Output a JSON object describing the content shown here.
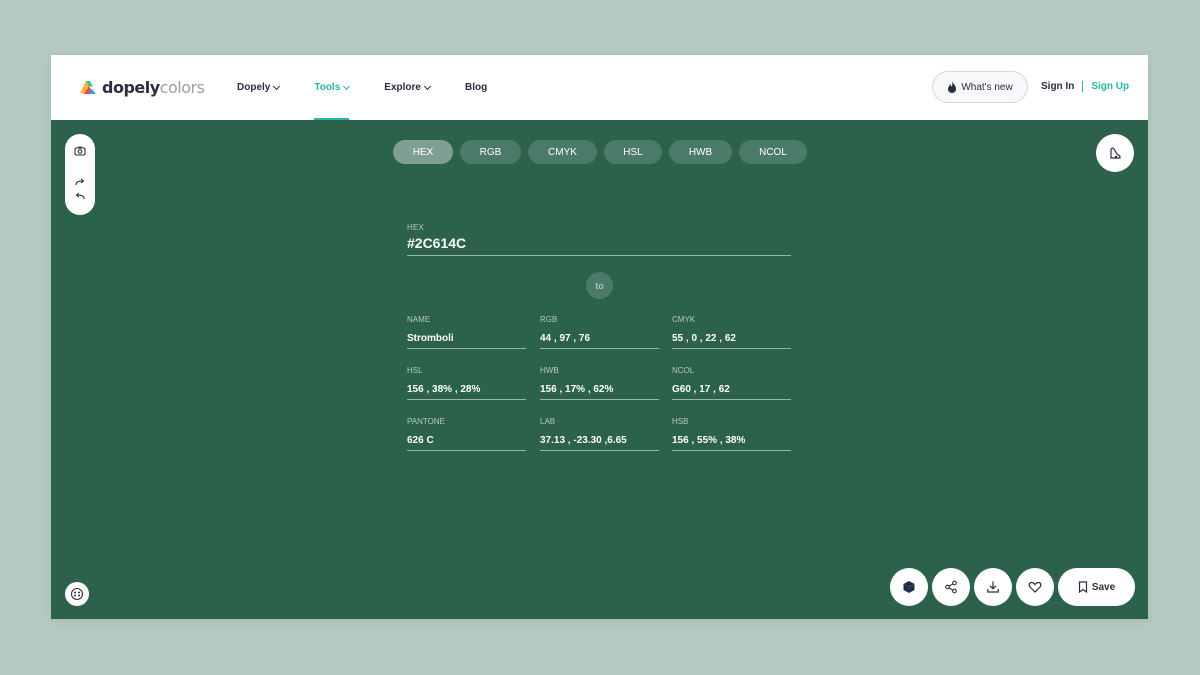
{
  "logo": {
    "part1": "dopely",
    "part2": "colors"
  },
  "nav": {
    "items": [
      {
        "label": "Dopely",
        "dropdown": true,
        "active": false
      },
      {
        "label": "Tools",
        "dropdown": true,
        "active": true
      },
      {
        "label": "Explore",
        "dropdown": true,
        "active": false
      },
      {
        "label": "Blog",
        "dropdown": false,
        "active": false
      }
    ],
    "whats_new": "What's new",
    "sign_in": "Sign In",
    "sign_up": "Sign Up"
  },
  "colors": {
    "background": "#2C614C",
    "accent": "#27B5A4",
    "tab": "#4C7A68",
    "tab_active": "#7F9F92"
  },
  "format_tabs": [
    {
      "label": "HEX",
      "active": true
    },
    {
      "label": "RGB",
      "active": false
    },
    {
      "label": "CMYK",
      "active": false
    },
    {
      "label": "HSL",
      "active": false
    },
    {
      "label": "HWB",
      "active": false
    },
    {
      "label": "NCOL",
      "active": false
    }
  ],
  "input": {
    "label": "HEX",
    "value": "#2C614C"
  },
  "to_label": "to",
  "results": [
    {
      "label": "NAME",
      "value": "Stromboli"
    },
    {
      "label": "RGB",
      "value": "44 , 97 , 76"
    },
    {
      "label": "CMYK",
      "value": "55 , 0 , 22 , 62"
    },
    {
      "label": "HSL",
      "value": "156 , 38% , 28%"
    },
    {
      "label": "HWB",
      "value": "156 , 17% , 62%"
    },
    {
      "label": "NCOL",
      "value": "G60 , 17 , 62"
    },
    {
      "label": "PANTONE",
      "value": "626 C"
    },
    {
      "label": "LAB",
      "value": "37.13 , -23.30 ,6.65"
    },
    {
      "label": "HSB",
      "value": "156 , 55% , 38%"
    }
  ],
  "actions": {
    "save_label": "Save"
  },
  "icons": [
    "camera-icon",
    "redo-icon",
    "undo-icon",
    "color-blind-icon",
    "accessibility-icon",
    "cube-icon",
    "share-icon",
    "download-icon",
    "heart-icon",
    "bookmark-icon",
    "flame-icon"
  ]
}
